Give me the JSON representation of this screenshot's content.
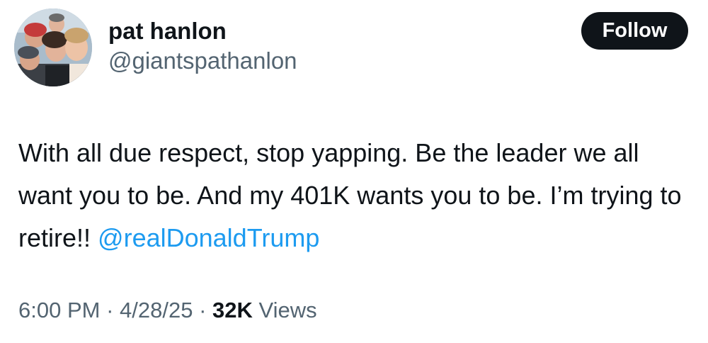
{
  "author": {
    "display_name": "pat hanlon",
    "handle": "@giantspathanlon"
  },
  "follow_label": "Follow",
  "tweet": {
    "text": "With all due respect, stop yapping. Be the leader we all want you to be. And my 401K wants you to be. I’m trying to retire!!",
    "mention": "@realDonaldTrump"
  },
  "meta": {
    "time": "6:00 PM",
    "separator": "·",
    "date": "4/28/25",
    "views_count": "32K",
    "views_label": "Views"
  },
  "colors": {
    "text": "#0f1419",
    "secondary": "#536471",
    "link": "#1d9bf0",
    "button_bg": "#0f1419"
  }
}
